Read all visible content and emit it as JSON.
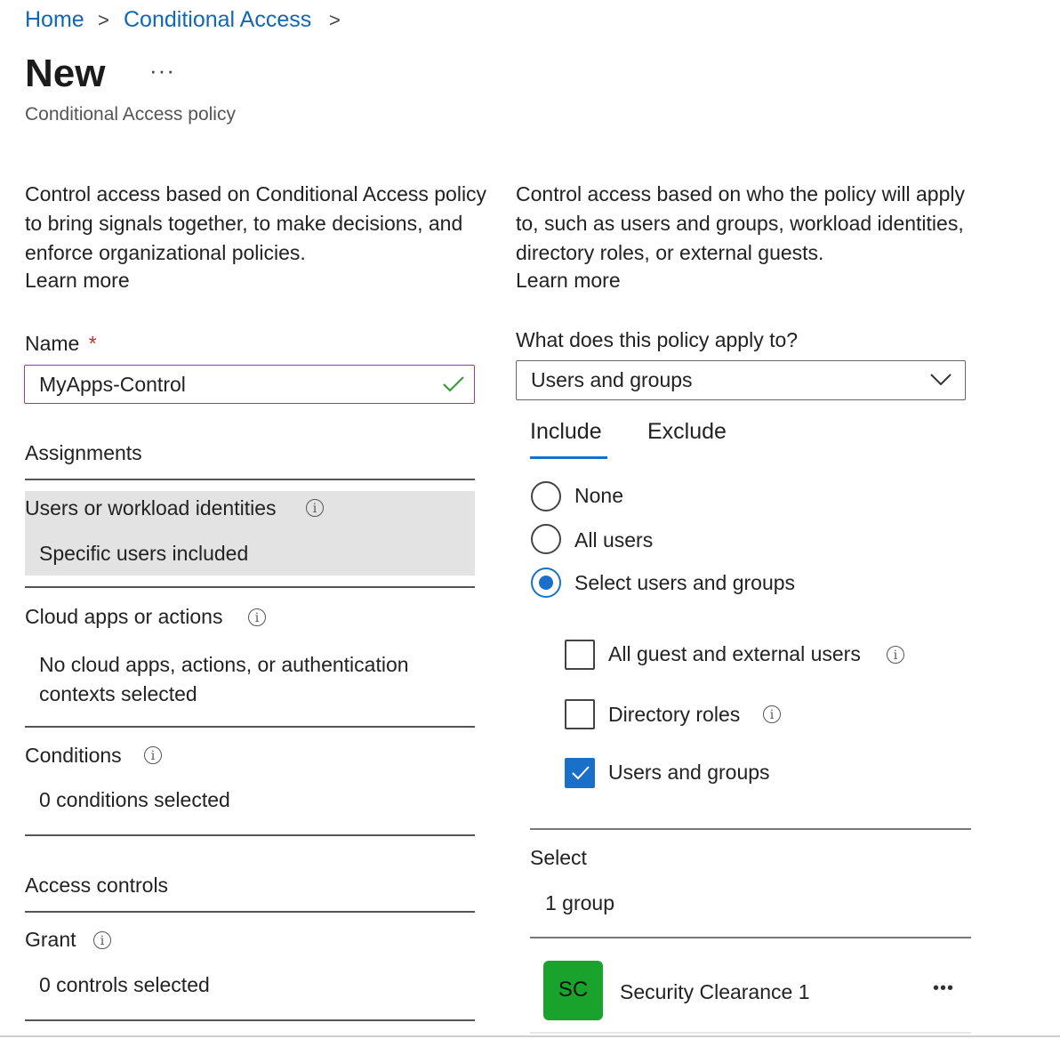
{
  "breadcrumb": {
    "home": "Home",
    "conditional_access": "Conditional Access"
  },
  "header": {
    "title": "New",
    "more": "···",
    "subtitle": "Conditional Access policy"
  },
  "left": {
    "description": "Control access based on Conditional Access policy to bring signals together, to make decisions, and enforce organizational policies.",
    "learn_more": "Learn more",
    "name_label": "Name",
    "name_required": "*",
    "name_value": "MyApps-Control",
    "assignments_heading": "Assignments",
    "users_label": "Users or workload identities",
    "users_value": "Specific users included",
    "cloud_label": "Cloud apps or actions",
    "cloud_value": "No cloud apps, actions, or authentication contexts selected",
    "conditions_label": "Conditions",
    "conditions_value": "0 conditions selected",
    "access_heading": "Access controls",
    "grant_label": "Grant",
    "grant_value": "0 controls selected"
  },
  "right": {
    "description": "Control access based on who the policy will apply to, such as users and groups, workload identities, directory roles, or external guests.",
    "learn_more": "Learn more",
    "apply_label": "What does this policy apply to?",
    "apply_value": "Users and groups",
    "tab_include": "Include",
    "tab_exclude": "Exclude",
    "radio_none": "None",
    "radio_all": "All users",
    "radio_select": "Select users and groups",
    "chk_guest": "All guest and external users",
    "chk_roles": "Directory roles",
    "chk_users": "Users and groups",
    "select_label": "Select",
    "select_value": "1 group",
    "group_initials": "SC",
    "group_name": "Security Clearance 1",
    "group_more": "•••"
  },
  "colors": {
    "link": "#1068b5",
    "accent": "#1a70c9",
    "valid": "#3a9a3a",
    "avatar_bg": "#19a32c",
    "required": "#c23030"
  }
}
